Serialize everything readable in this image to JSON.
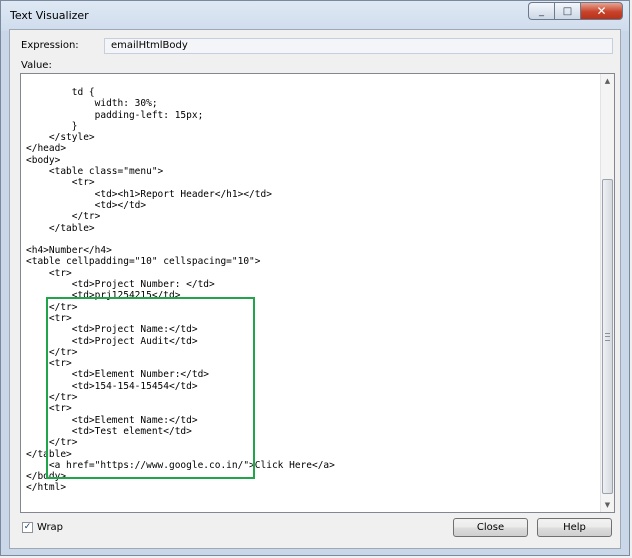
{
  "window": {
    "title": "Text Visualizer",
    "minimize_glyph": "_",
    "maximize_glyph": "□",
    "close_glyph": "✕"
  },
  "expression": {
    "label": "Expression:",
    "value": "emailHtmlBody"
  },
  "value_label": "Value:",
  "code_text": "        td {\n            width: 30%;\n            padding-left: 15px;\n        }\n    </style>\n</head>\n<body>\n    <table class=\"menu\">\n        <tr>\n            <td><h1>Report Header</h1></td>\n            <td></td>\n        </tr>\n    </table>\n\n<h4>Number</h4>\n<table cellpadding=\"10\" cellspacing=\"10\">\n    <tr>\n        <td>Project Number: </td>\n        <td>prj1254215</td>\n    </tr>\n    <tr>\n        <td>Project Name:</td>\n        <td>Project Audit</td>\n    </tr>\n    <tr>\n        <td>Element Number:</td>\n        <td>154-154-15454</td>\n    </tr>\n    <tr>\n        <td>Element Name:</td>\n        <td>Test element</td>\n    </tr>\n</table>\n    <a href=\"https://www.google.co.in/\">Click Here</a>\n</body>\n</html>",
  "wrap": {
    "label": "Wrap",
    "checked": true,
    "check_glyph": "✓"
  },
  "buttons": {
    "close": "Close",
    "help": "Help"
  },
  "highlight_color": "#22a54a",
  "icons": {
    "scroll_up": "▲",
    "scroll_down": "▼"
  }
}
